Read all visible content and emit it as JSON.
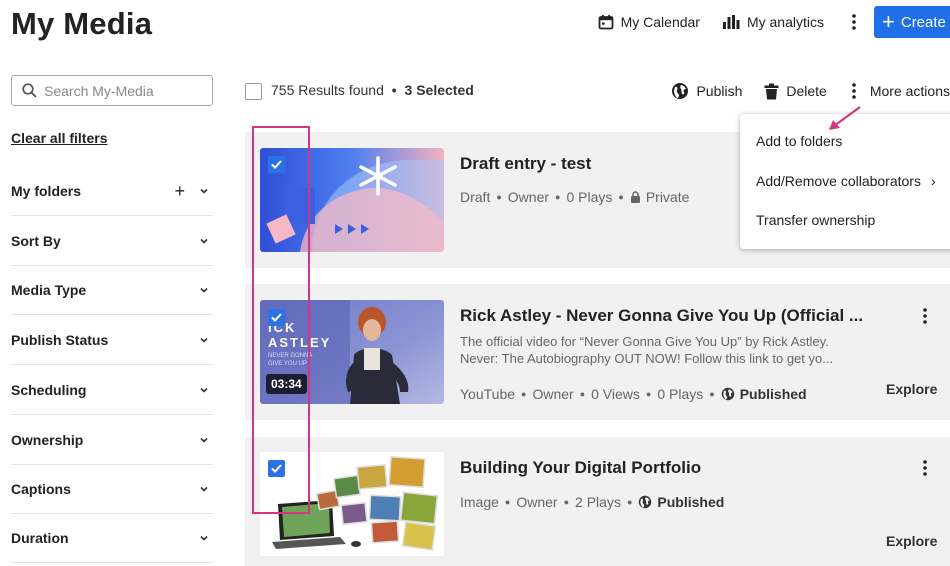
{
  "header": {
    "title": "My Media",
    "calendar_label": "My Calendar",
    "analytics_label": "My analytics",
    "create_label": "Create"
  },
  "sidebar": {
    "search_placeholder": "Search My-Media",
    "clear_filters": "Clear all filters",
    "filters": [
      {
        "label": "My folders"
      },
      {
        "label": "Sort By"
      },
      {
        "label": "Media Type"
      },
      {
        "label": "Publish Status"
      },
      {
        "label": "Scheduling"
      },
      {
        "label": "Ownership"
      },
      {
        "label": "Captions"
      },
      {
        "label": "Duration"
      }
    ]
  },
  "list_header": {
    "results": "755 Results found",
    "dot": "•",
    "selected": "3 Selected",
    "publish_label": "Publish",
    "delete_label": "Delete",
    "more_label": "More actions"
  },
  "more_actions_menu": {
    "items": [
      {
        "label": "Add to folders"
      },
      {
        "label": "Add/Remove collaborators",
        "submenu": "›"
      },
      {
        "label": "Transfer ownership"
      }
    ]
  },
  "entries": [
    {
      "title": "Draft entry - test",
      "meta": {
        "status": "Draft",
        "owner": "Owner",
        "plays": "0 Plays",
        "privacy": "Private"
      }
    },
    {
      "title": "Rick Astley - Never Gonna Give You Up (Official ...",
      "description": "The official video for “Never Gonna Give You Up” by Rick Astley. Never: The Autobiography OUT NOW! Follow this link to get yo...",
      "duration": "03:34",
      "thumb_text": "ICK\nASTLEY",
      "thumb_subtext": "NEVER GONNA\nGIVE YOU UP",
      "meta": {
        "source": "YouTube",
        "owner": "Owner",
        "views": "0 Views",
        "plays": "0 Plays",
        "status": "Published"
      },
      "explore": "Explore"
    },
    {
      "title": "Building Your Digital Portfolio",
      "meta": {
        "type": "Image",
        "owner": "Owner",
        "plays": "2 Plays",
        "status": "Published"
      },
      "explore": "Explore"
    }
  ],
  "colors": {
    "accent": "#1f6fe8",
    "checkbox": "#2a72e6",
    "annotation": "#d63384",
    "entry_bg": "#f1f1f1"
  }
}
